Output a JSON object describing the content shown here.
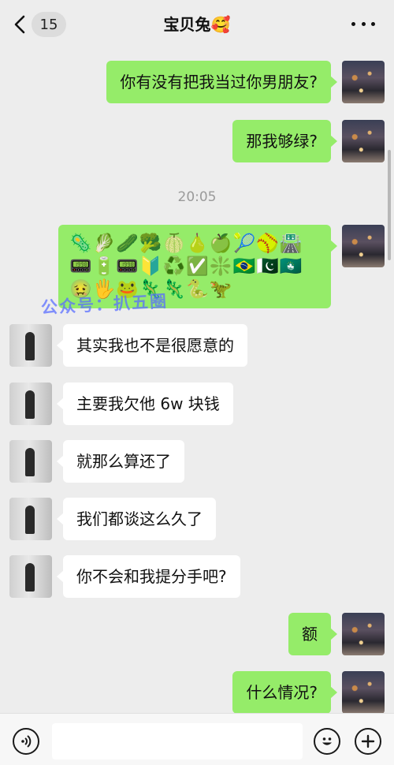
{
  "header": {
    "unread_count": "15",
    "title": "宝贝兔🥰"
  },
  "messages": [
    {
      "from": "me",
      "text": "你有没有把我当过你男朋友?"
    },
    {
      "from": "me",
      "text": "那我够绿?"
    },
    {
      "from": "me",
      "text": "🦠🥬🥒🥦🍈🍐🍏🎾🥎🛣️📟🔋📟🔰♻️✅❇️🇧🇷🇵🇰🇲🇴🤢🖐️🐸🦎🦎🐍🦖"
    },
    {
      "from": "her",
      "text": "其实我也不是很愿意的"
    },
    {
      "from": "her",
      "text": "主要我欠他 6w 块钱"
    },
    {
      "from": "her",
      "text": "就那么算还了"
    },
    {
      "from": "her",
      "text": "我们都谈这么久了"
    },
    {
      "from": "her",
      "text": "你不会和我提分手吧?"
    },
    {
      "from": "me",
      "text": "额"
    },
    {
      "from": "me",
      "text": "什么情况?"
    }
  ],
  "timestamp": "20:05",
  "watermark": "公众号：扒五圈",
  "colors": {
    "my_bubble": "#95ec69",
    "her_bubble": "#ffffff",
    "background": "#ededed"
  }
}
